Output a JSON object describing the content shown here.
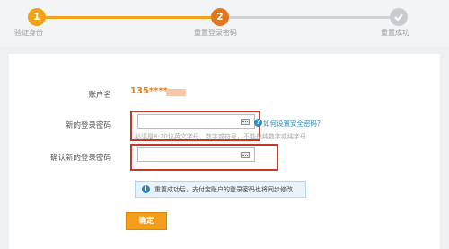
{
  "steps": [
    {
      "number": "1",
      "label": "验证身份"
    },
    {
      "number": "2",
      "label": "重置登录密码"
    },
    {
      "number": "",
      "label": "重置成功"
    }
  ],
  "form": {
    "account_label": "账户名",
    "account_value": "135****",
    "new_password_label": "新的登录密码",
    "confirm_password_label": "确认新的登录密码",
    "help_icon": "?",
    "help_link": "如何设置安全密码?",
    "hint": "必须是8-20位英文字母、数字或符号，不能是纯数字或纯字母",
    "info_icon": "i",
    "info_text": "重置成功后，支付宝账户的登录密码也将同步修改",
    "confirm_button": "确定"
  },
  "colors": {
    "accent": "#f0a21a",
    "active_step": "#e0771e",
    "link": "#2a8ec3",
    "highlight": "#c0392b"
  }
}
